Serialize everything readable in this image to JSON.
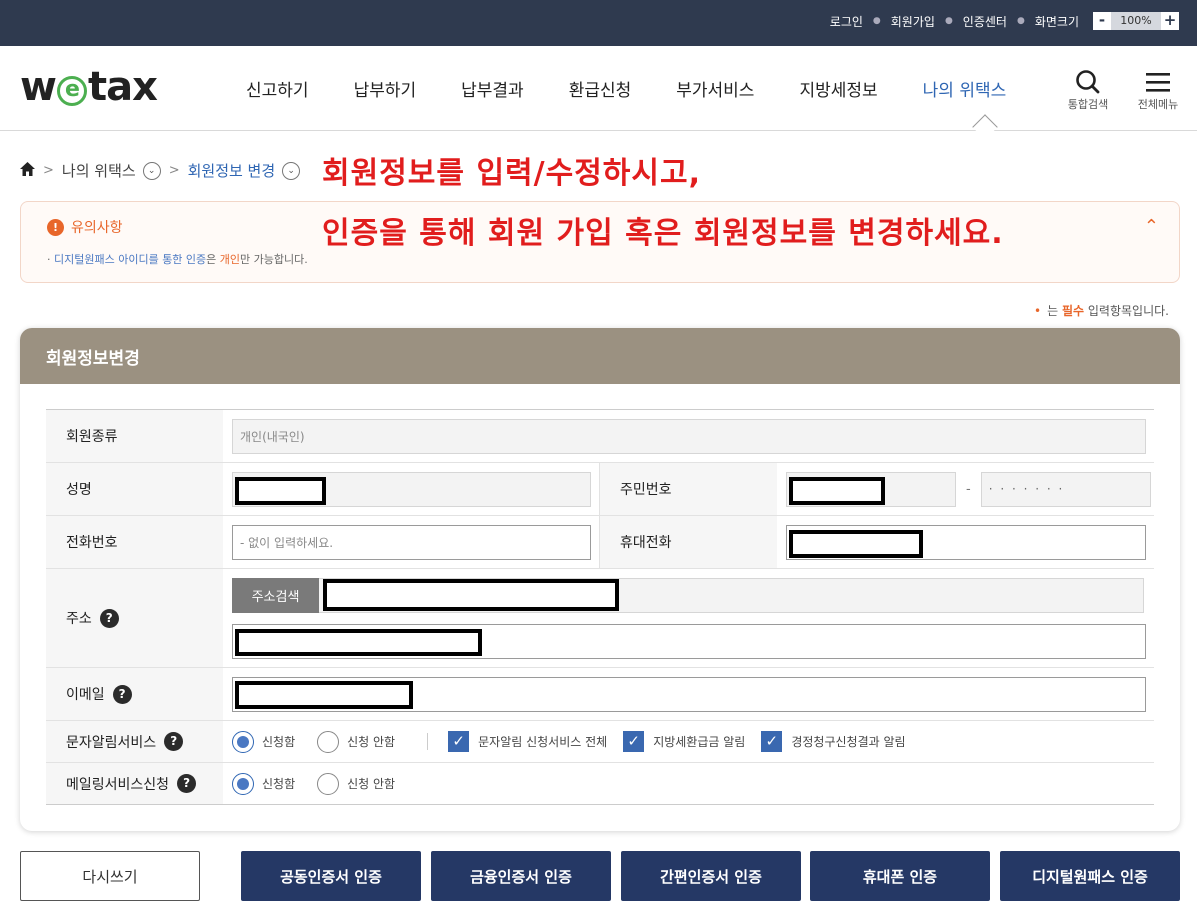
{
  "topbar": {
    "login": "로그인",
    "signup": "회원가입",
    "cert_center": "인증센터",
    "screen_size": "화면크기",
    "zoom_minus": "-",
    "zoom_value": "100%",
    "zoom_plus": "+"
  },
  "header": {
    "logo_w": "w",
    "logo_e": "e",
    "logo_tax": "tax",
    "nav": [
      "신고하기",
      "납부하기",
      "납부결과",
      "환급신청",
      "부가서비스",
      "지방세정보",
      "나의 위택스"
    ],
    "search_label": "통합검색",
    "menu_label": "전체메뉴"
  },
  "breadcrumb": {
    "level1": "나의 위택스",
    "level2": "회원정보 변경"
  },
  "annotation": {
    "line1": "회원정보를 입력/수정하시고,",
    "line2": "인증을 통해 회원 가입 혹은 회원정보를 변경하세요."
  },
  "notice": {
    "title": "유의사항",
    "desc_pre": "디지털원패스 아이디를 통한 인증",
    "desc_mid": "은 ",
    "desc_highlight": "개인",
    "desc_post": "만 가능합니다."
  },
  "required_note": {
    "dot": "•",
    "pre": "는 ",
    "em": "필수",
    "post": " 입력항목입니다."
  },
  "form": {
    "title": "회원정보변경",
    "member_type_label": "회원종류",
    "member_type_value": "개인(내국인)",
    "name_label": "성명",
    "rrn_label": "주민번호",
    "rrn_dash": "-",
    "rrn_masked": "· · · · · · ·",
    "phone_label": "전화번호",
    "phone_placeholder": "- 없이 입력하세요.",
    "mobile_label": "휴대전화",
    "address_label": "주소",
    "address_search": "주소검색",
    "email_label": "이메일",
    "sms_label": "문자알림서비스",
    "mailing_label": "메일링서비스신청",
    "apply": "신청함",
    "not_apply": "신청 안함",
    "sms_checks": [
      "문자알림 신청서비스 전체",
      "지방세환급금 알림",
      "경정청구신청결과 알림"
    ]
  },
  "buttons": {
    "reset": "다시쓰기",
    "joint_cert": "공동인증서 인증",
    "financial_cert": "금융인증서 인증",
    "simple_cert": "간편인증서 인증",
    "phone_cert": "휴대폰 인증",
    "onepass_cert": "디지털원패스 인증"
  },
  "colors": {
    "topbar": "#2f3a4f",
    "panel_header": "#9b9181",
    "primary_button": "#253865",
    "annotation": "#e11d1d",
    "accent_orange": "#e8662a"
  }
}
